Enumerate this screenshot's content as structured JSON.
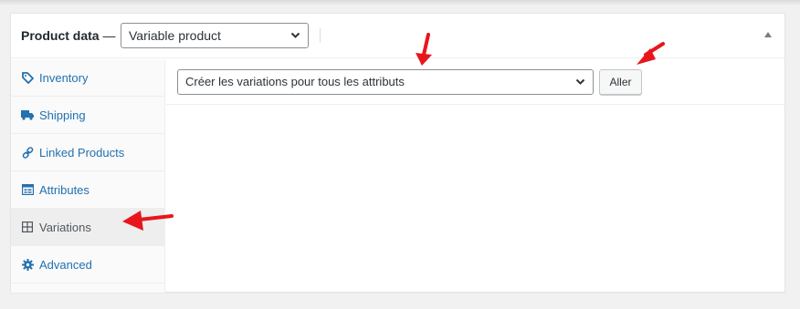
{
  "header": {
    "title": "Product data",
    "dash": "—",
    "product_type": "Variable product"
  },
  "tabs": [
    {
      "label": "Inventory",
      "icon": "tag-icon",
      "active": false
    },
    {
      "label": "Shipping",
      "icon": "truck-icon",
      "active": false
    },
    {
      "label": "Linked Products",
      "icon": "link-icon",
      "active": false
    },
    {
      "label": "Attributes",
      "icon": "attributes-icon",
      "active": false
    },
    {
      "label": "Variations",
      "icon": "grid-icon",
      "active": true
    },
    {
      "label": "Advanced",
      "icon": "gear-icon",
      "active": false
    }
  ],
  "variations": {
    "action_select": "Créer les variations pour tous les attributs",
    "go_button": "Aller"
  },
  "colors": {
    "link": "#2271b1",
    "annotation_arrow": "#e8161b"
  }
}
